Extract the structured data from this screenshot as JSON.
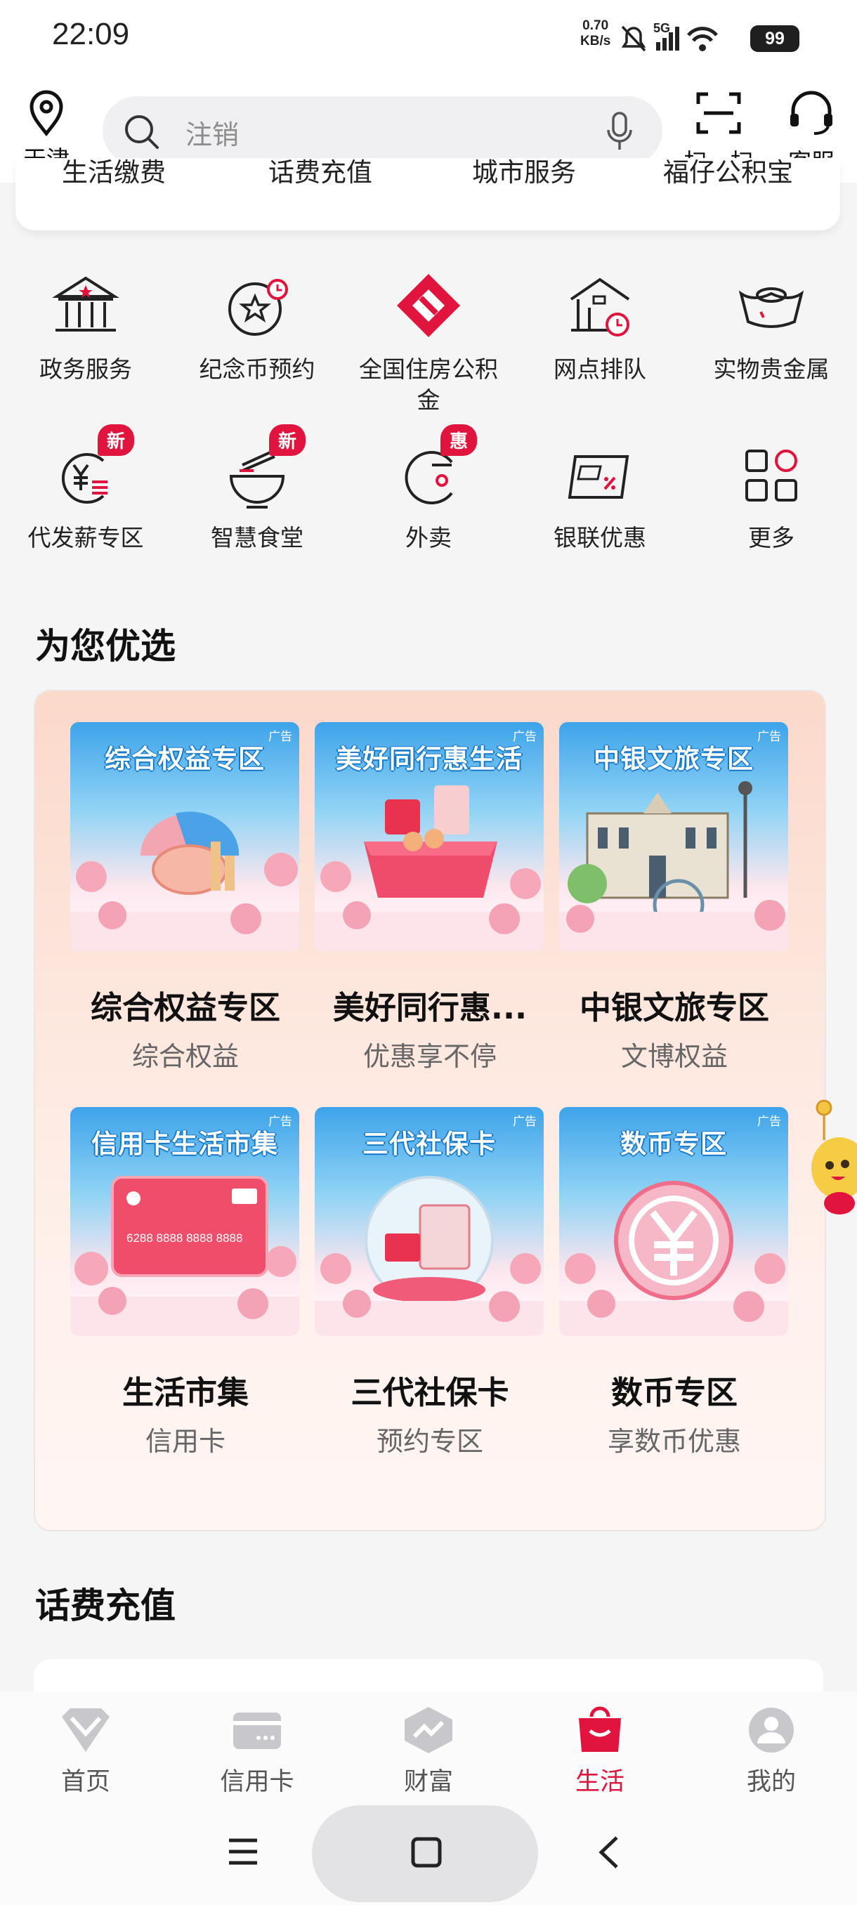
{
  "status_bar": {
    "time": "22:09",
    "net_speed_value": "0.70",
    "net_speed_unit": "KB/s",
    "signal_label": "5G",
    "battery": "99"
  },
  "header": {
    "location": "天津",
    "search_placeholder": "注销",
    "scan_label": "扫一扫",
    "service_label": "客服"
  },
  "category_strip": [
    "生活缴费",
    "话费充值",
    "城市服务",
    "福仔公积宝"
  ],
  "services": [
    {
      "label": "政务服务",
      "icon": "government-building-icon",
      "badge": ""
    },
    {
      "label": "纪念币预约",
      "icon": "commemorative-coin-icon",
      "badge": ""
    },
    {
      "label": "全国住房公积金",
      "icon": "housing-fund-icon",
      "badge": ""
    },
    {
      "label": "网点排队",
      "icon": "branch-queue-icon",
      "badge": ""
    },
    {
      "label": "实物贵金属",
      "icon": "gold-ingot-icon",
      "badge": ""
    },
    {
      "label": "代发薪专区",
      "icon": "salary-icon",
      "badge": "新"
    },
    {
      "label": "智慧食堂",
      "icon": "canteen-bowl-icon",
      "badge": "新"
    },
    {
      "label": "外卖",
      "icon": "takeout-icon",
      "badge": "惠"
    },
    {
      "label": "银联优惠",
      "icon": "unionpay-card-icon",
      "badge": ""
    },
    {
      "label": "更多",
      "icon": "more-grid-icon",
      "badge": ""
    }
  ],
  "recommend": {
    "title": "为您优选",
    "ad_tag": "广告",
    "cards": [
      {
        "image_title": "综合权益专区",
        "name": "综合权益专区",
        "sub": "综合权益"
      },
      {
        "image_title": "美好同行惠生活",
        "name": "美好同行惠...",
        "sub": "优惠享不停"
      },
      {
        "image_title": "中银文旅专区",
        "name": "中银文旅专区",
        "sub": "文博权益"
      },
      {
        "image_title": "信用卡生活市集",
        "name": "生活市集",
        "sub": "信用卡"
      },
      {
        "image_title": "三代社保卡",
        "name": "三代社保卡",
        "sub": "预约专区"
      },
      {
        "image_title": "数币专区",
        "name": "数币专区",
        "sub": "享数币优惠"
      }
    ]
  },
  "topup": {
    "title": "话费充值"
  },
  "tabs": [
    {
      "label": "首页",
      "icon": "home-diamond-icon",
      "active": false
    },
    {
      "label": "信用卡",
      "icon": "credit-card-icon",
      "active": false
    },
    {
      "label": "财富",
      "icon": "wealth-chart-icon",
      "active": false
    },
    {
      "label": "生活",
      "icon": "shopping-bag-icon",
      "active": true
    },
    {
      "label": "我的",
      "icon": "profile-icon",
      "active": false
    }
  ],
  "colors": {
    "accent": "#e0143c",
    "background": "#f5f5f6"
  }
}
